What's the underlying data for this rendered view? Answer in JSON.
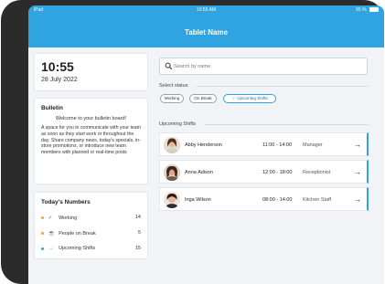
{
  "status_bar": {
    "left": "iPad",
    "time": "10:55 AM",
    "battery": "55 %"
  },
  "app": {
    "title": "Tablet Name"
  },
  "clock": {
    "time": "10:55",
    "date": "28 July 2022"
  },
  "bulletin": {
    "heading": "Bulletin",
    "welcome": "Welcome to your bulletin board!",
    "body": "A space for you to communicate with your team as soon as they start work or throughout the day. Share company news, today's specials, in-store promotions, or introduce new team members with planned or real-time posts"
  },
  "numbers": {
    "heading": "Today's Numbers",
    "rows": [
      {
        "label": "Working",
        "value": "14",
        "icon": "check-icon",
        "glyph": "✓",
        "color": "#2e9e4f"
      },
      {
        "label": "People on Break",
        "value": "5",
        "icon": "coffee-icon",
        "glyph": "☕",
        "color": "#f0a32b"
      },
      {
        "label": "Upcoming Shifts",
        "value": "15",
        "icon": "arrow-right-icon",
        "glyph": "→",
        "color": "#2fa4e0"
      }
    ]
  },
  "search": {
    "placeholder": "Search by name",
    "value": ""
  },
  "status_filter": {
    "label": "Select status",
    "chips": [
      {
        "label": "Working",
        "active": false
      },
      {
        "label": "On Break",
        "active": false
      },
      {
        "label": "Upcoming Shifts",
        "active": true
      }
    ]
  },
  "upcoming": {
    "label": "Upcoming Shifts",
    "shifts": [
      {
        "name": "Abby Henderson",
        "time": "11:00 - 14:00",
        "role": "Manager"
      },
      {
        "name": "Anna Adison",
        "time": "12:00 - 18:00",
        "role": "Receptionist"
      },
      {
        "name": "Inga Wilson",
        "time": "08:00 - 14:00",
        "role": "Kitchen Staff"
      }
    ]
  },
  "colors": {
    "accent": "#2fa4e0",
    "background": "#f1f3f6",
    "frame": "#2b2b2b"
  }
}
